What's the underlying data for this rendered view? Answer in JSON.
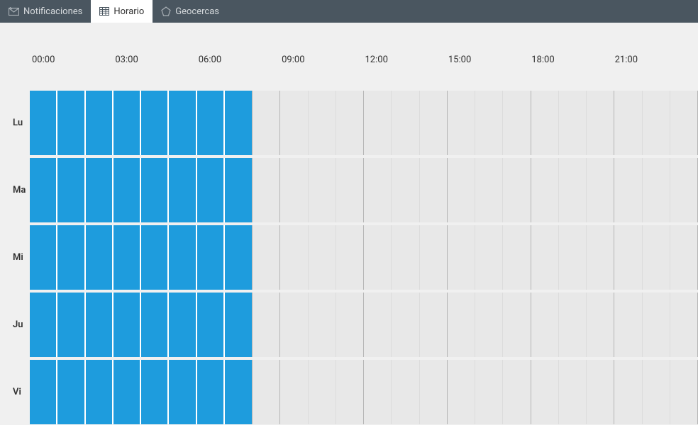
{
  "tabs": [
    {
      "label": "Notificaciones",
      "icon": "envelope-icon",
      "active": false
    },
    {
      "label": "Horario",
      "icon": "grid-icon",
      "active": true
    },
    {
      "label": "Geocercas",
      "icon": "pentagon-icon",
      "active": false
    }
  ],
  "timeHeaders": [
    "00:00",
    "03:00",
    "06:00",
    "09:00",
    "12:00",
    "15:00",
    "18:00",
    "21:00"
  ],
  "days": [
    {
      "label": "Lu"
    },
    {
      "label": "Ma"
    },
    {
      "label": "Mi"
    },
    {
      "label": "Ju"
    },
    {
      "label": "Vi"
    }
  ],
  "hoursPerDay": 24,
  "selectedHoursEnd": 8,
  "colors": {
    "selected": "#1e9cdd",
    "tabBar": "#4a5660",
    "background": "#f0f0f0",
    "gridBg": "#e8e8e8"
  }
}
